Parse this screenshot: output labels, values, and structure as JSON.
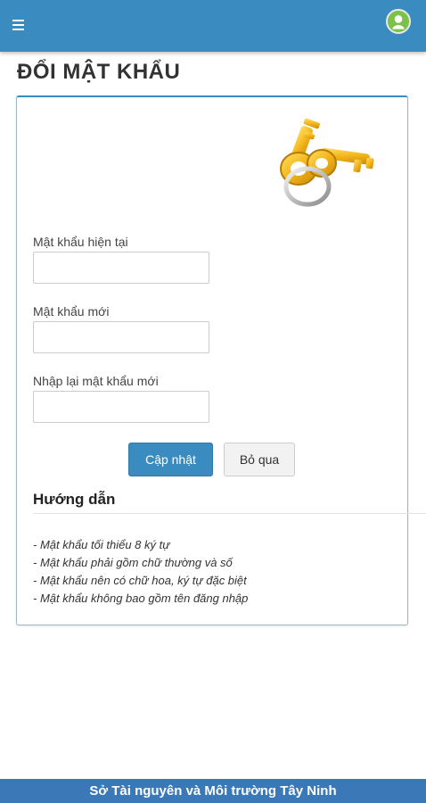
{
  "header": {
    "menu_icon": "hamburger-menu-icon",
    "avatar_icon": "user-avatar-icon",
    "colors": {
      "bar": "#3a8cc0",
      "avatar": "#7cc24a"
    }
  },
  "page": {
    "title": "ĐỔI MẬT KHẨU"
  },
  "form": {
    "image_icon": "keys-icon",
    "current_password": {
      "label": "Mật khẩu hiện tại",
      "value": ""
    },
    "new_password": {
      "label": "Mật khẩu mới",
      "value": ""
    },
    "confirm_password": {
      "label": "Nhập lại mật khẩu mới",
      "value": ""
    },
    "update_label": "Cập nhật",
    "skip_label": "Bỏ qua"
  },
  "guide": {
    "title": "Hướng dẫn",
    "items": [
      "- Mật khẩu tối thiểu 8 ký tự",
      "- Mật khẩu phải gồm chữ thường và số",
      "- Mật khẩu nên có chữ hoa, ký tự đặc biệt",
      "- Mật khẩu không bao gồm tên đăng nhập"
    ]
  },
  "footer": {
    "text": "Sở Tài nguyên và Môi trường Tây Ninh",
    "color": "#3a78b8"
  }
}
